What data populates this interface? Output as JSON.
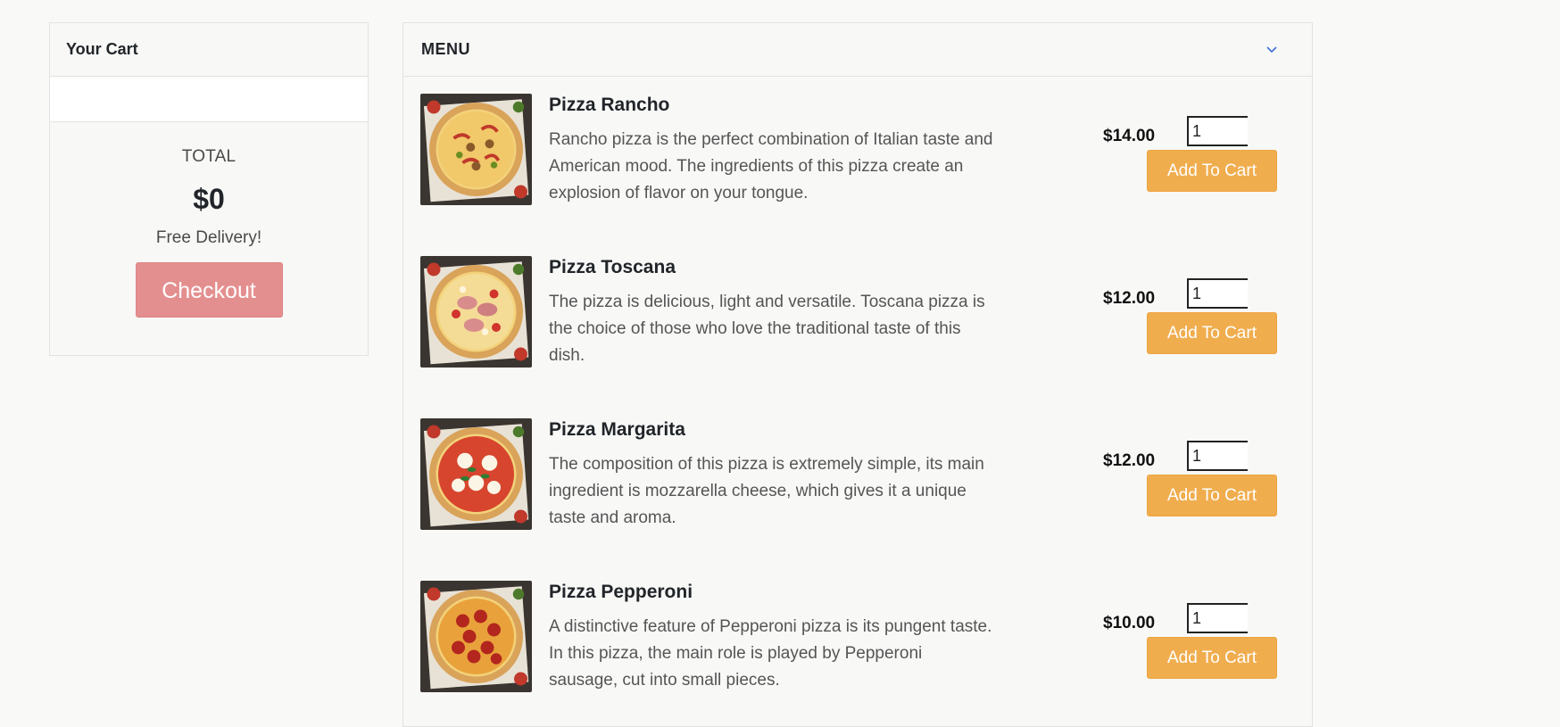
{
  "cart": {
    "title": "Your Cart",
    "total_label": "TOTAL",
    "total_value": "$0",
    "delivery_text": "Free Delivery!",
    "checkout_label": "Checkout"
  },
  "menu": {
    "title": "MENU",
    "items": [
      {
        "name": "Pizza Rancho",
        "description": "Rancho pizza is the perfect combination of Italian taste and American mood. The ingredients of this pizza create an explosion of flavor on your tongue.",
        "price": "$14.00",
        "quantity": "1",
        "add_label": "Add To Cart",
        "topping": "rancho"
      },
      {
        "name": "Pizza Toscana",
        "description": "The pizza is delicious, light and versatile. Toscana pizza is the choice of those who love the traditional taste of this dish.",
        "price": "$12.00",
        "quantity": "1",
        "add_label": "Add To Cart",
        "topping": "toscana"
      },
      {
        "name": "Pizza Margarita",
        "description": "The composition of this pizza is extremely simple, its main ingredient is mozzarella cheese, which gives it a unique taste and aroma.",
        "price": "$12.00",
        "quantity": "1",
        "add_label": "Add To Cart",
        "topping": "margarita"
      },
      {
        "name": "Pizza Pepperoni",
        "description": "A distinctive feature of Pepperoni pizza is its pungent taste. In this pizza, the main role is played by Pepperoni sausage, cut into small pieces.",
        "price": "$10.00",
        "quantity": "1",
        "add_label": "Add To Cart",
        "topping": "pepperoni"
      }
    ]
  },
  "colors": {
    "checkout": "#e48f8f",
    "add_to_cart": "#f0ad4e",
    "chevron": "#3b6fd6"
  },
  "icons": {
    "menu_toggle": "chevron-down-icon"
  }
}
